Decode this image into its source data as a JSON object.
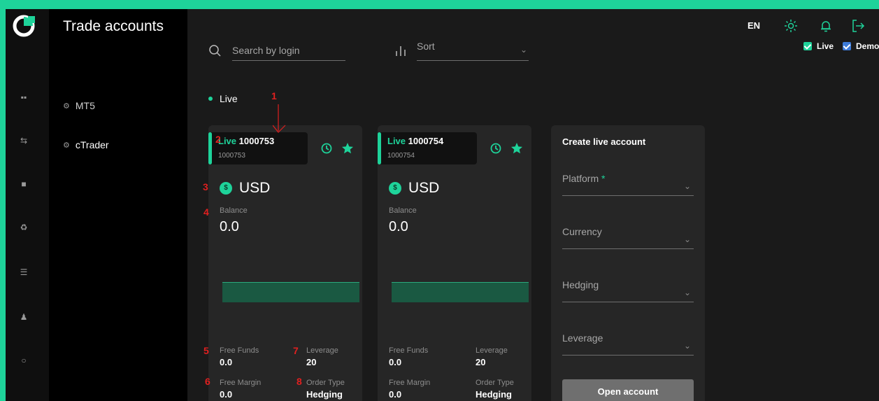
{
  "sidebar": {
    "title": "Trade accounts",
    "items": [
      {
        "label": "MT5",
        "icon": "gear-icon"
      },
      {
        "label": "cTrader",
        "icon": "gear-icon"
      }
    ]
  },
  "toolbar": {
    "search_placeholder": "Search by login",
    "sort_label": "Sort"
  },
  "section": {
    "label": "Live"
  },
  "accounts": [
    {
      "type_label": "Live",
      "number": "1000753",
      "login": "1000753",
      "currency": "USD",
      "currency_symbol": "$",
      "balance_label": "Balance",
      "balance": "0.0",
      "free_funds_label": "Free Funds",
      "free_funds": "0.0",
      "leverage_label": "Leverage",
      "leverage": "20",
      "free_margin_label": "Free Margin",
      "free_margin": "0.0",
      "order_type_label": "Order Type",
      "order_type": "Hedging"
    },
    {
      "type_label": "Live",
      "number": "1000754",
      "login": "1000754",
      "currency": "USD",
      "currency_symbol": "$",
      "balance_label": "Balance",
      "balance": "0.0",
      "free_funds_label": "Free Funds",
      "free_funds": "0.0",
      "leverage_label": "Leverage",
      "leverage": "20",
      "free_margin_label": "Free Margin",
      "free_margin": "0.0",
      "order_type_label": "Order Type",
      "order_type": "Hedging"
    }
  ],
  "create": {
    "title": "Create live account",
    "fields": [
      {
        "label": "Platform",
        "required": "*"
      },
      {
        "label": "Currency"
      },
      {
        "label": "Hedging"
      },
      {
        "label": "Leverage"
      }
    ],
    "button": "Open account"
  },
  "header": {
    "language": "EN",
    "filters": [
      {
        "label": "Live",
        "color": "#1ed39a"
      },
      {
        "label": "Demo",
        "color": "#3d7bd9"
      }
    ]
  },
  "annotations": [
    "1",
    "2",
    "3",
    "4",
    "5",
    "6",
    "7",
    "8"
  ],
  "colors": {
    "accent": "#1ed39a",
    "annotation": "#e02020"
  }
}
